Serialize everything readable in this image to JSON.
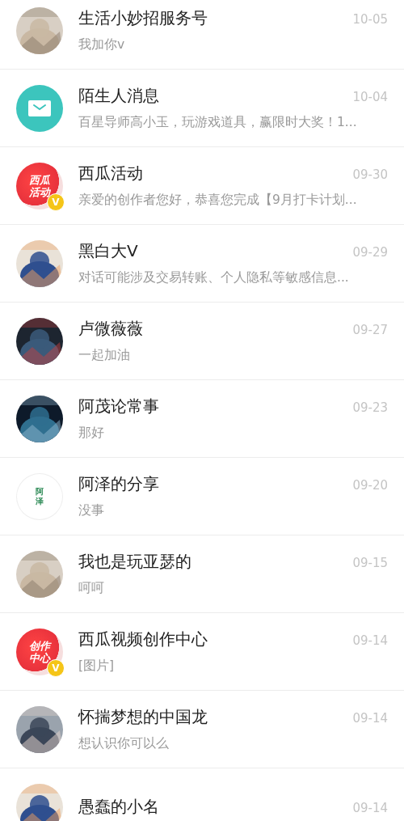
{
  "conversations": [
    {
      "name": "生活小妙招服务号",
      "preview": "我加你v",
      "time": "10-05"
    },
    {
      "name": "陌生人消息",
      "preview": "百星导师高小玉，玩游戏道具，赢限时大奖！1...",
      "time": "10-04",
      "avatar": {
        "kind": "mail"
      }
    },
    {
      "name": "西瓜活动",
      "preview": "亲爱的创作者您好，恭喜您完成【9月打卡计划...",
      "time": "09-30",
      "avatar": {
        "kind": "logo",
        "lines": [
          "西瓜",
          "活动"
        ],
        "badge": "V"
      }
    },
    {
      "name": "黑白大V",
      "preview": "对话可能涉及交易转账、个人隐私等敏感信息...",
      "time": "09-29"
    },
    {
      "name": "卢微薇薇",
      "preview": "一起加油",
      "time": "09-27"
    },
    {
      "name": "阿茂论常事",
      "preview": "那好",
      "time": "09-23"
    },
    {
      "name": "阿泽的分享",
      "preview": "没事",
      "time": "09-20",
      "avatar": {
        "kind": "text",
        "lines": [
          "阿",
          "泽"
        ]
      }
    },
    {
      "name": "我也是玩亚瑟的",
      "preview": "呵呵",
      "time": "09-15"
    },
    {
      "name": "西瓜视频创作中心",
      "preview": "[图片]",
      "time": "09-14",
      "avatar": {
        "kind": "logo",
        "lines": [
          "创作",
          "中心"
        ],
        "badge": "V"
      }
    },
    {
      "name": "怀揣梦想的中国龙",
      "preview": "想认识你可以么",
      "time": "09-14"
    },
    {
      "name": "愚蠢的小名",
      "time": "09-14"
    }
  ]
}
